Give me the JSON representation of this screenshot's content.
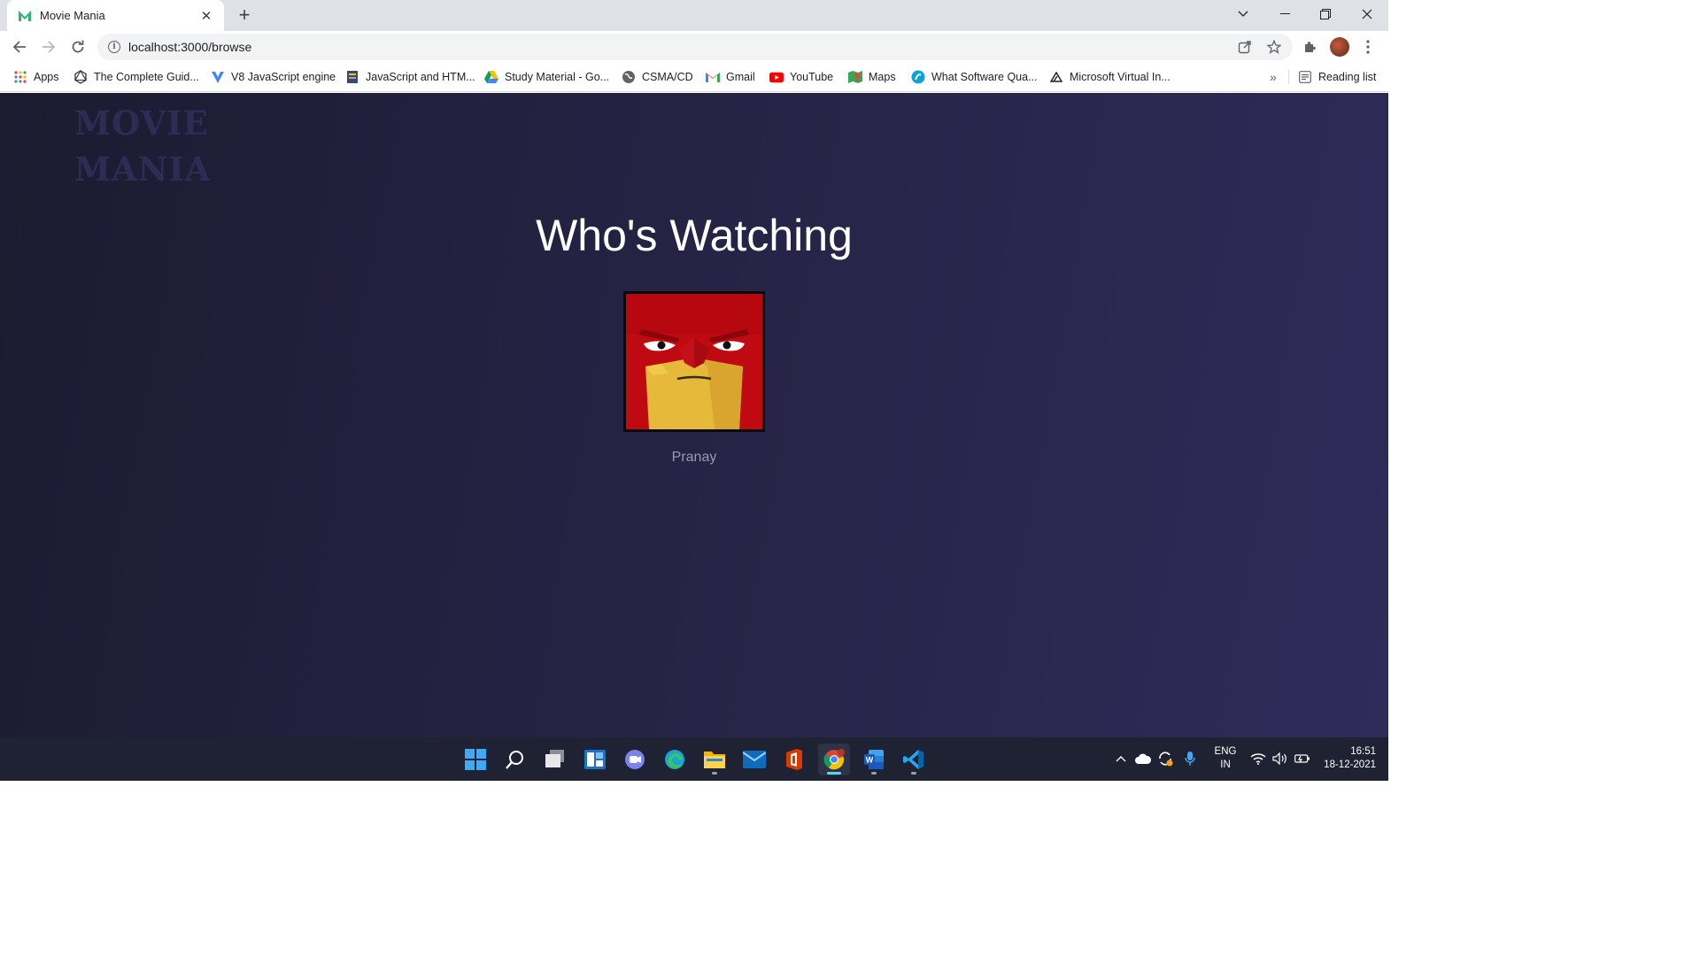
{
  "browser": {
    "tab": {
      "title": "Movie Mania",
      "favicon": "movie-mania-m-icon"
    },
    "address_bar": {
      "url": "localhost:3000/browse"
    },
    "bookmarks": [
      {
        "label": "Apps",
        "icon": "apps-grid-icon"
      },
      {
        "label": "The Complete Guid...",
        "icon": "graphql-icon"
      },
      {
        "label": "V8 JavaScript engine",
        "icon": "v8-icon"
      },
      {
        "label": "JavaScript and HTM...",
        "icon": "bookmark-page-icon"
      },
      {
        "label": "Study Material - Go...",
        "icon": "google-drive-icon"
      },
      {
        "label": "CSMA/CD",
        "icon": "globe-icon"
      },
      {
        "label": "Gmail",
        "icon": "gmail-icon"
      },
      {
        "label": "YouTube",
        "icon": "youtube-icon"
      },
      {
        "label": "Maps",
        "icon": "maps-icon"
      },
      {
        "label": "What Software Qua...",
        "icon": "bookmark-blue-icon"
      },
      {
        "label": "Microsoft Virtual In...",
        "icon": "triangle-icon"
      }
    ],
    "more_bookmarks": "»",
    "reading_list": "Reading list"
  },
  "page": {
    "logo_line1": "MOVIE",
    "logo_line2": "MANIA",
    "heading": "Who's Watching",
    "profiles": [
      {
        "name": "Pranay",
        "avatar": "angry-red-face-avatar"
      }
    ]
  },
  "taskbar": {
    "apps": [
      "start-icon",
      "search-icon",
      "task-view-icon",
      "widgets-icon",
      "teams-chat-icon",
      "edge-icon",
      "file-explorer-icon",
      "mail-icon",
      "office-icon",
      "chrome-icon",
      "word-icon",
      "vscode-icon"
    ],
    "language_line1": "ENG",
    "language_line2": "IN",
    "time": "16:51",
    "date": "18-12-2021"
  },
  "colors": {
    "page_bg_start": "#1c1b30",
    "page_bg_end": "#2f2b5a",
    "logo": "#2e2b55",
    "heading": "#ffffff",
    "profile_name": "#9a9aaa",
    "avatar_red": "#c00a12",
    "avatar_yellow": "#e6b93a"
  }
}
